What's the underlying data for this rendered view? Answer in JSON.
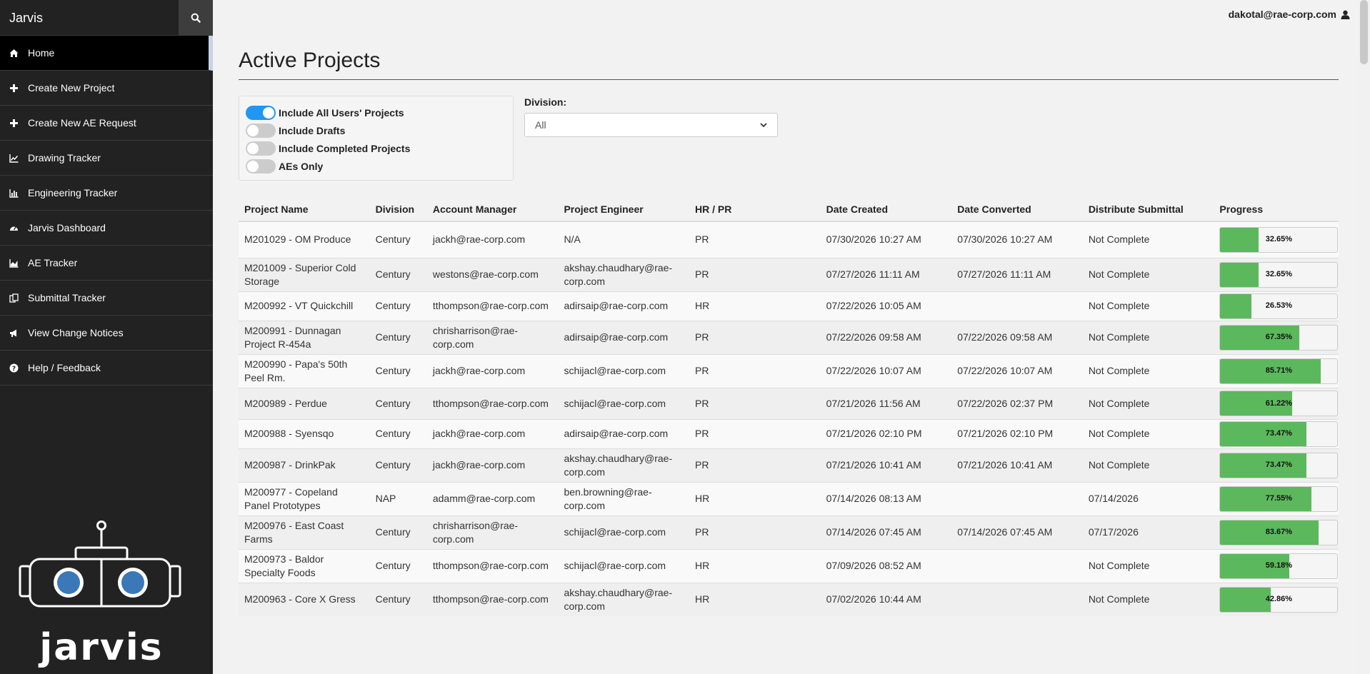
{
  "app": {
    "title": "Jarvis",
    "user": "dakotal@rae-corp.com"
  },
  "sidebar": {
    "items": [
      {
        "label": "Home",
        "icon": "home-icon"
      },
      {
        "label": "Create New Project",
        "icon": "plus-icon"
      },
      {
        "label": "Create New AE Request",
        "icon": "plus-icon"
      },
      {
        "label": "Drawing Tracker",
        "icon": "line-chart-icon"
      },
      {
        "label": "Engineering Tracker",
        "icon": "bar-chart-icon"
      },
      {
        "label": "Jarvis Dashboard",
        "icon": "dashboard-icon"
      },
      {
        "label": "AE Tracker",
        "icon": "area-chart-icon"
      },
      {
        "label": "Submittal Tracker",
        "icon": "copy-icon"
      },
      {
        "label": "View Change Notices",
        "icon": "bullhorn-icon"
      },
      {
        "label": "Help / Feedback",
        "icon": "question-circle-icon"
      }
    ],
    "logo_text": "jarvis"
  },
  "main": {
    "title": "Active Projects",
    "filters": [
      {
        "label": "Include All Users' Projects",
        "on": true
      },
      {
        "label": "Include Drafts",
        "on": false
      },
      {
        "label": "Include Completed Projects",
        "on": false
      },
      {
        "label": "AEs Only",
        "on": false
      }
    ],
    "division": {
      "label": "Division:",
      "selected": "All"
    },
    "columns": [
      "Project Name",
      "Division",
      "Account Manager",
      "Project Engineer",
      "HR / PR",
      "Date Created",
      "Date Converted",
      "Distribute Submittal",
      "Progress"
    ],
    "rows": [
      {
        "name": "M201029 - OM Produce",
        "division": "Century",
        "am": "jackh@rae-corp.com",
        "pe": "N/A",
        "hrpr": "PR",
        "created": "07/30/2026 10:27 AM",
        "converted": "07/30/2026 10:27 AM",
        "submittal": "Not Complete",
        "progress": 32.65,
        "progress_label": "32.65%"
      },
      {
        "name": "M201009 - Superior Cold Storage",
        "division": "Century",
        "am": "westons@rae-corp.com",
        "pe": "akshay.chaudhary@rae-corp.com",
        "hrpr": "PR",
        "created": "07/27/2026 11:11 AM",
        "converted": "07/27/2026 11:11 AM",
        "submittal": "Not Complete",
        "progress": 32.65,
        "progress_label": "32.65%"
      },
      {
        "name": "M200992 - VT Quickchill",
        "division": "Century",
        "am": "tthompson@rae-corp.com",
        "pe": "adirsaip@rae-corp.com",
        "hrpr": "HR",
        "created": "07/22/2026 10:05 AM",
        "converted": "",
        "submittal": "Not Complete",
        "progress": 26.53,
        "progress_label": "26.53%"
      },
      {
        "name": "M200991 - Dunnagan Project R-454a",
        "division": "Century",
        "am": "chrisharrison@rae-corp.com",
        "pe": "adirsaip@rae-corp.com",
        "hrpr": "PR",
        "created": "07/22/2026 09:58 AM",
        "converted": "07/22/2026 09:58 AM",
        "submittal": "Not Complete",
        "progress": 67.35,
        "progress_label": "67.35%"
      },
      {
        "name": "M200990 - Papa's 50th Peel Rm.",
        "division": "Century",
        "am": "jackh@rae-corp.com",
        "pe": "schijacl@rae-corp.com",
        "hrpr": "PR",
        "created": "07/22/2026 10:07 AM",
        "converted": "07/22/2026 10:07 AM",
        "submittal": "Not Complete",
        "progress": 85.71,
        "progress_label": "85.71%"
      },
      {
        "name": "M200989 - Perdue",
        "division": "Century",
        "am": "tthompson@rae-corp.com",
        "pe": "schijacl@rae-corp.com",
        "hrpr": "PR",
        "created": "07/21/2026 11:56 AM",
        "converted": "07/22/2026 02:37 PM",
        "submittal": "Not Complete",
        "progress": 61.22,
        "progress_label": "61.22%"
      },
      {
        "name": "M200988 - Syensqo",
        "division": "Century",
        "am": "jackh@rae-corp.com",
        "pe": "adirsaip@rae-corp.com",
        "hrpr": "PR",
        "created": "07/21/2026 02:10 PM",
        "converted": "07/21/2026 02:10 PM",
        "submittal": "Not Complete",
        "progress": 73.47,
        "progress_label": "73.47%"
      },
      {
        "name": "M200987 - DrinkPak",
        "division": "Century",
        "am": "jackh@rae-corp.com",
        "pe": "akshay.chaudhary@rae-corp.com",
        "hrpr": "PR",
        "created": "07/21/2026 10:41 AM",
        "converted": "07/21/2026 10:41 AM",
        "submittal": "Not Complete",
        "progress": 73.47,
        "progress_label": "73.47%"
      },
      {
        "name": "M200977 - Copeland Panel Prototypes",
        "division": "NAP",
        "am": "adamm@rae-corp.com",
        "pe": "ben.browning@rae-corp.com",
        "hrpr": "HR",
        "created": "07/14/2026 08:13 AM",
        "converted": "",
        "submittal": "07/14/2026",
        "progress": 77.55,
        "progress_label": "77.55%"
      },
      {
        "name": "M200976 - East Coast Farms",
        "division": "Century",
        "am": "chrisharrison@rae-corp.com",
        "pe": "schijacl@rae-corp.com",
        "hrpr": "PR",
        "created": "07/14/2026 07:45 AM",
        "converted": "07/14/2026 07:45 AM",
        "submittal": "07/17/2026",
        "progress": 83.67,
        "progress_label": "83.67%"
      },
      {
        "name": "M200973 - Baldor Specialty Foods",
        "division": "Century",
        "am": "tthompson@rae-corp.com",
        "pe": "schijacl@rae-corp.com",
        "hrpr": "HR",
        "created": "07/09/2026 08:52 AM",
        "converted": "",
        "submittal": "Not Complete",
        "progress": 59.18,
        "progress_label": "59.18%"
      },
      {
        "name": "M200963 - Core X Gress",
        "division": "Century",
        "am": "tthompson@rae-corp.com",
        "pe": "akshay.chaudhary@rae-corp.com",
        "hrpr": "HR",
        "created": "07/02/2026 10:44 AM",
        "converted": "",
        "submittal": "Not Complete",
        "progress": 42.86,
        "progress_label": "42.86%"
      }
    ]
  }
}
